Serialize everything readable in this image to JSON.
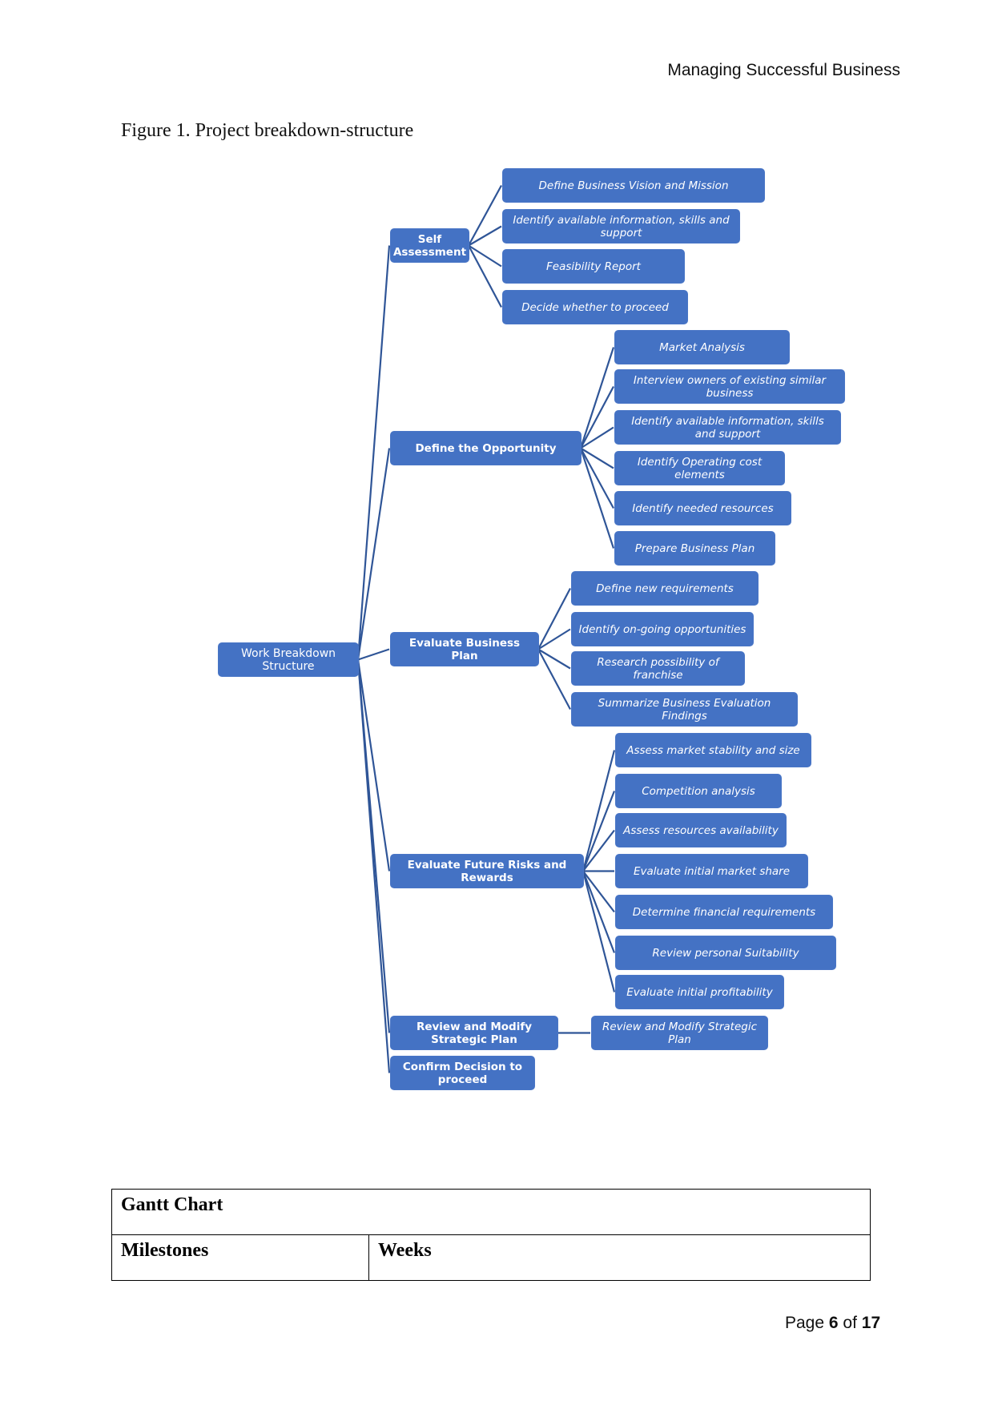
{
  "header": {
    "title": "Managing Successful Business"
  },
  "figure": {
    "caption": "Figure 1. Project breakdown-structure"
  },
  "wbs": {
    "color": "#4472c4",
    "line_color": "#2f5597",
    "root": {
      "label": "Work Breakdown Structure"
    },
    "branches": [
      {
        "label": "Self Assessment",
        "children": [
          "Define Business Vision and Mission",
          "Identify available information, skills and support",
          "Feasibility Report",
          "Decide whether to proceed"
        ]
      },
      {
        "label": "Define the Opportunity",
        "children": [
          "Market Analysis",
          "Interview owners of existing similar business",
          "Identify available information, skills and support",
          "Identify Operating cost elements",
          "Identify needed resources",
          "Prepare Business Plan"
        ]
      },
      {
        "label": "Evaluate Business Plan",
        "children": [
          "Define new requirements",
          "Identify on-going opportunities",
          "Research possibility of franchise",
          "Summarize Business Evaluation Findings"
        ]
      },
      {
        "label": "Evaluate Future Risks and Rewards",
        "children": [
          "Assess market stability and size",
          "Competition analysis",
          "Assess resources availability",
          "Evaluate initial market share",
          "Determine financial requirements",
          "Review personal Suitability",
          "Evaluate initial profitability"
        ]
      },
      {
        "label": "Review and Modify Strategic Plan",
        "children": [
          "Review and Modify Strategic Plan"
        ]
      },
      {
        "label": "Confirm Decision to proceed",
        "children": []
      }
    ]
  },
  "gantt": {
    "title": "Gantt Chart",
    "columns": [
      "Milestones",
      "Weeks"
    ]
  },
  "footer": {
    "page_prefix": "Page",
    "page": "6",
    "of": "of",
    "total": "17"
  }
}
